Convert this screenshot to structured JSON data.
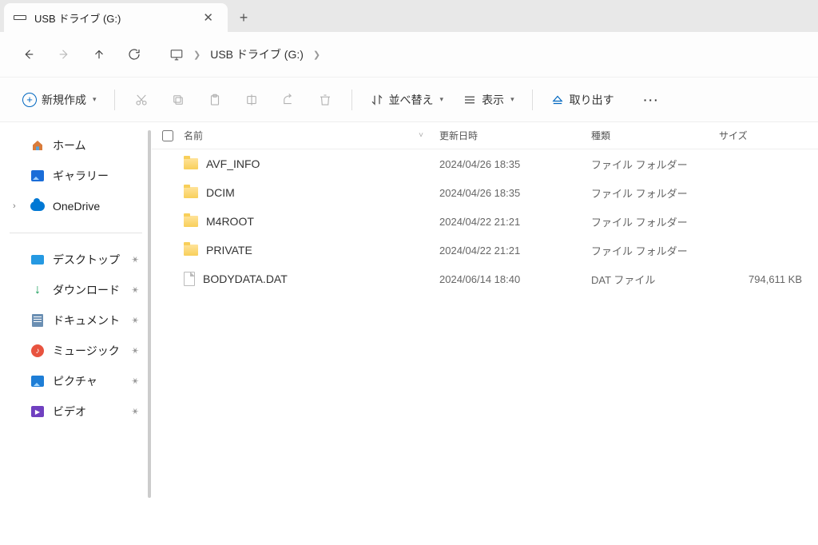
{
  "tab": {
    "title": "USB ドライブ (G:)"
  },
  "address": {
    "location": "USB ドライブ (G:)"
  },
  "toolbar": {
    "new_label": "新規作成",
    "sort_label": "並べ替え",
    "view_label": "表示",
    "eject_label": "取り出す"
  },
  "sidebar": {
    "top": [
      {
        "label": "ホーム",
        "icon": "home",
        "exp": ""
      },
      {
        "label": "ギャラリー",
        "icon": "gallery",
        "exp": ""
      },
      {
        "label": "OneDrive",
        "icon": "cloud",
        "exp": "›"
      }
    ],
    "quick": [
      {
        "label": "デスクトップ",
        "icon": "desktop"
      },
      {
        "label": "ダウンロード",
        "icon": "download"
      },
      {
        "label": "ドキュメント",
        "icon": "doc"
      },
      {
        "label": "ミュージック",
        "icon": "music"
      },
      {
        "label": "ピクチャ",
        "icon": "pic"
      },
      {
        "label": "ビデオ",
        "icon": "video"
      }
    ]
  },
  "columns": {
    "name": "名前",
    "date": "更新日時",
    "type": "種類",
    "size": "サイズ"
  },
  "files": [
    {
      "name": "AVF_INFO",
      "date": "2024/04/26 18:35",
      "type": "ファイル フォルダー",
      "size": "",
      "kind": "folder"
    },
    {
      "name": "DCIM",
      "date": "2024/04/26 18:35",
      "type": "ファイル フォルダー",
      "size": "",
      "kind": "folder"
    },
    {
      "name": "M4ROOT",
      "date": "2024/04/22 21:21",
      "type": "ファイル フォルダー",
      "size": "",
      "kind": "folder"
    },
    {
      "name": "PRIVATE",
      "date": "2024/04/22 21:21",
      "type": "ファイル フォルダー",
      "size": "",
      "kind": "folder"
    },
    {
      "name": "BODYDATA.DAT",
      "date": "2024/06/14 18:40",
      "type": "DAT ファイル",
      "size": "794,611 KB",
      "kind": "file"
    }
  ]
}
